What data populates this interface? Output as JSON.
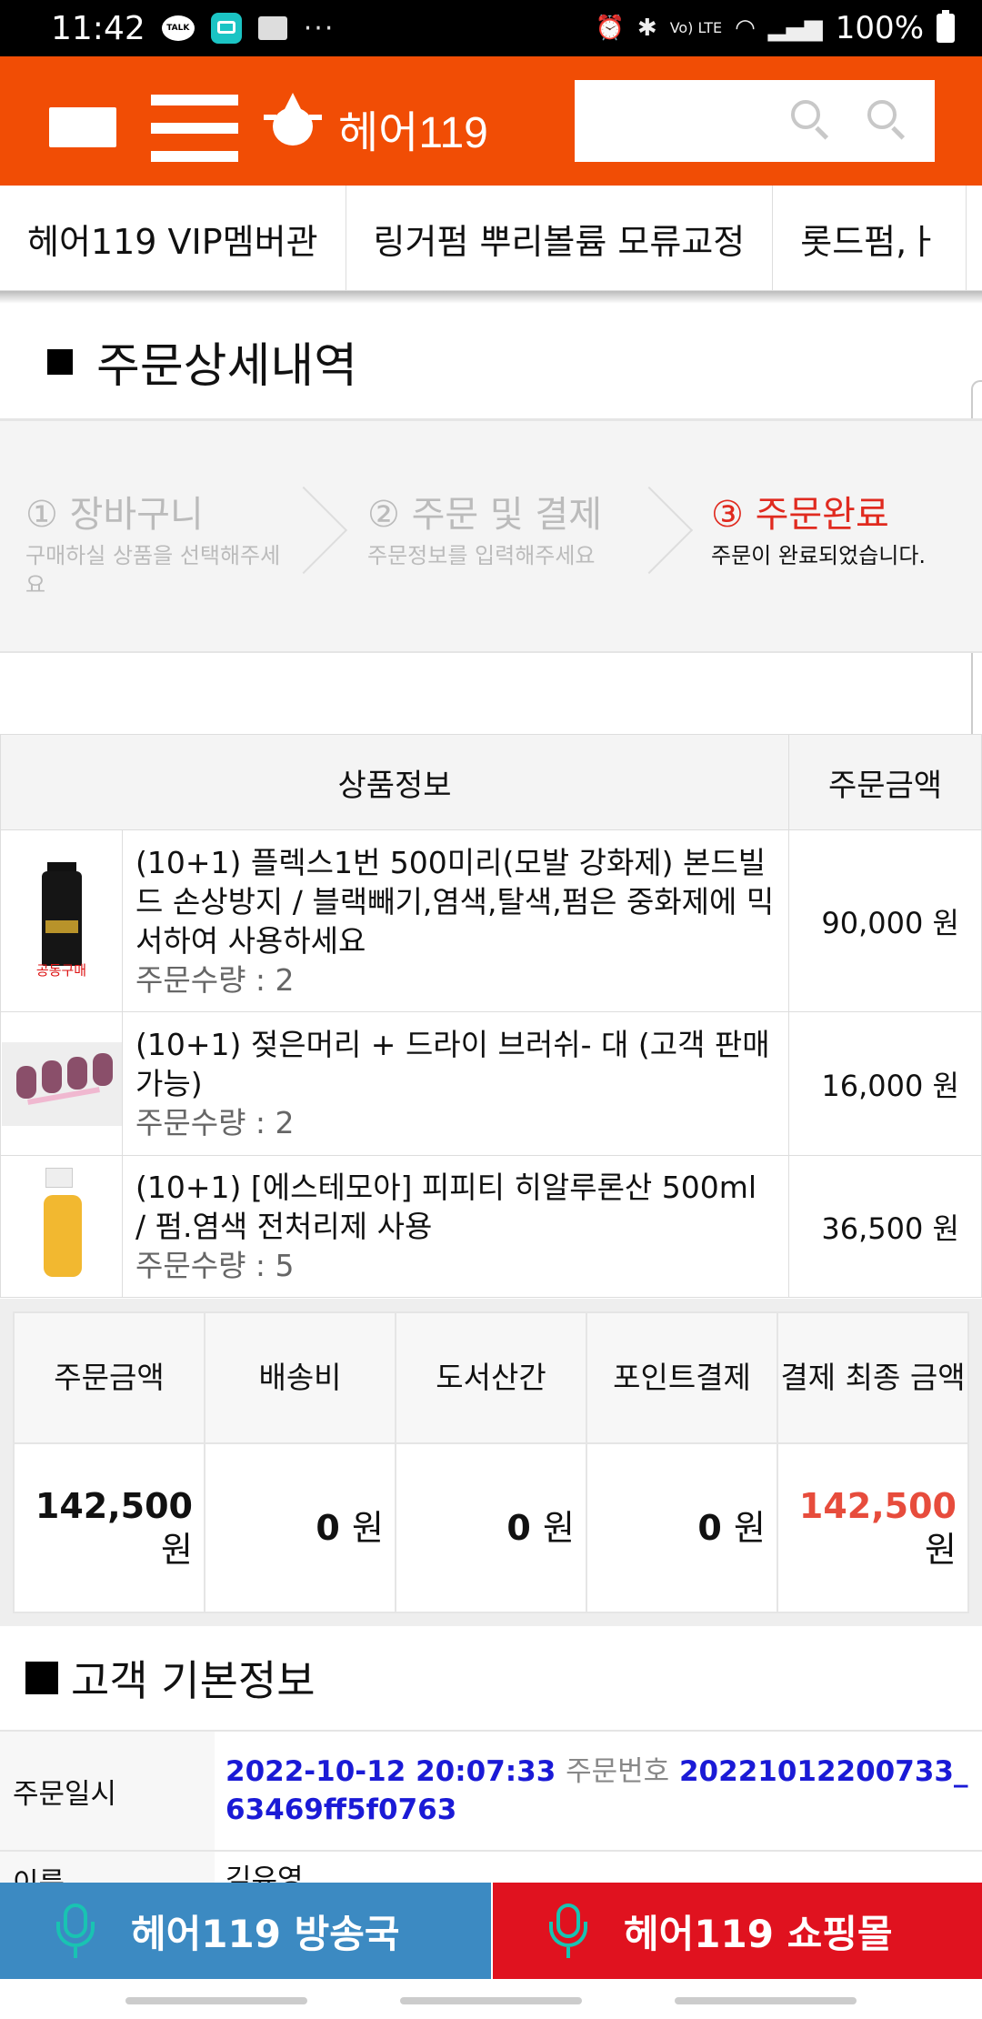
{
  "status_bar": {
    "time": "11:42",
    "battery": "100%",
    "talk_label": "TALK",
    "more": "···",
    "network": "Vo) LTE"
  },
  "header": {
    "logo_text": "헤어119",
    "search_placeholder": ""
  },
  "tabs": [
    {
      "label": "헤어119 VIP멤버관"
    },
    {
      "label": "링거펌 뿌리볼륨 모류교정"
    },
    {
      "label": "롯드펌,ㅏ"
    }
  ],
  "page_title": "주문상세내역",
  "steps": [
    {
      "title": "① 장바구니",
      "sub": "구매하실 상품을 선택해주세요"
    },
    {
      "title": "② 주문 및 결제",
      "sub": "주문정보를 입력해주세요"
    },
    {
      "title": "③ 주문완료",
      "sub": "주문이 완료되었습니다."
    }
  ],
  "order_table": {
    "headers": {
      "product": "상품정보",
      "amount": "주문금액"
    },
    "items": [
      {
        "name": "(10+1) 플렉스1번 500미리(모발 강화제) 본드빌드 손상방지 / 블랙빼기,염색,탈색,펌은 중화제에 믹서하여 사용하세요",
        "qty": "주문수량 : 2",
        "price": "90,000 원",
        "thumb_label": "공동구매"
      },
      {
        "name": "(10+1) 젖은머리 + 드라이 브러쉬- 대 (고객 판매 가능)",
        "qty": "주문수량 : 2",
        "price": "16,000 원"
      },
      {
        "name": "(10+1) [에스테모아] 피피티 히알루론산 500ml / 펌.염색 전처리제 사용",
        "qty": "주문수량 : 5",
        "price": "36,500 원"
      }
    ]
  },
  "summary": {
    "headers": [
      "주문금액",
      "배송비",
      "도서산간",
      "포인트결제",
      "결제 최종 금액"
    ],
    "values": [
      {
        "num": "142,500",
        "unit": "원"
      },
      {
        "num": "0",
        "unit": "원"
      },
      {
        "num": "0",
        "unit": "원"
      },
      {
        "num": "0",
        "unit": "원"
      },
      {
        "num": "142,500",
        "unit": "원"
      }
    ]
  },
  "customer": {
    "title": "고객 기본정보",
    "order_date_label": "주문일시",
    "order_date": "2022-10-12 20:07:33",
    "order_no_label": "주문번호",
    "order_no": "20221012200733_63469ff5f0763",
    "name_label": "이름",
    "name_value": "김유영"
  },
  "bottom_bar": {
    "broadcast": "헤어119 방송국",
    "shop": "헤어119 쇼핑몰"
  },
  "colors": {
    "brand_orange": "#f14d05",
    "accent_red": "#e02a1f",
    "blue_button": "#3c8ac2",
    "red_button": "#e0121f",
    "link_blue": "#1a1ad6"
  }
}
